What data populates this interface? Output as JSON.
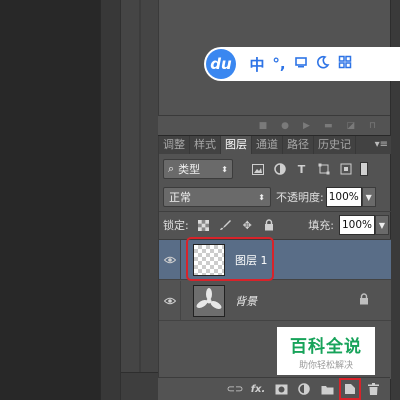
{
  "ime_toolbar": {
    "logo": "du",
    "lang": "中",
    "punct": "°,",
    "items": [
      "keyboard-icon",
      "moon-icon",
      "grid-icon"
    ]
  },
  "tabs": [
    {
      "label": "调整",
      "active": false
    },
    {
      "label": "样式",
      "active": false
    },
    {
      "label": "图层",
      "active": true
    },
    {
      "label": "通道",
      "active": false
    },
    {
      "label": "路径",
      "active": false
    },
    {
      "label": "历史记",
      "active": false
    }
  ],
  "filter": {
    "kind_label": "类型",
    "icons": [
      "image-filter-icon",
      "adjustment-filter-icon",
      "type-filter-icon",
      "shape-filter-icon",
      "smart-object-filter-icon"
    ]
  },
  "blend": {
    "mode": "正常",
    "opacity_label": "不透明度:",
    "opacity_value": "100%"
  },
  "lock": {
    "label": "锁定:",
    "fill_label": "填充:",
    "fill_value": "100%"
  },
  "layers": [
    {
      "name": "图层 1",
      "selected": true,
      "thumbnail": "transparent"
    },
    {
      "name": "背景",
      "selected": false,
      "thumbnail": "background",
      "locked": true
    }
  ],
  "watermark": {
    "title": "百科全说",
    "subtitle": "助你轻松解决"
  },
  "bottom_icons": [
    "link-layers-icon",
    "fx-icon",
    "add-mask-icon",
    "adjustment-layer-icon",
    "new-group-icon",
    "new-layer-icon",
    "delete-layer-icon"
  ],
  "colors": {
    "selected_layer": "#596d87",
    "highlight": "#d8232a",
    "ime_blue": "#3a87f0"
  }
}
